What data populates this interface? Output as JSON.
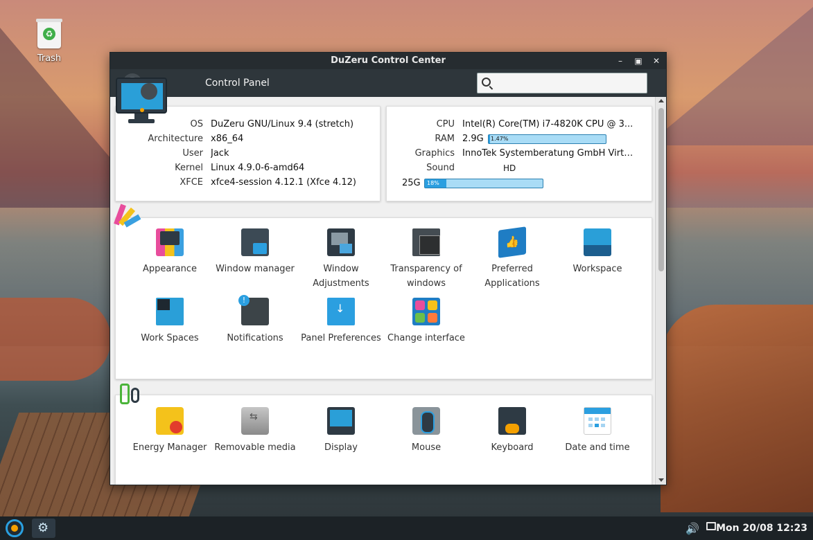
{
  "desktop": {
    "trash_label": "Trash"
  },
  "window": {
    "title": "DuZeru Control Center",
    "controls": [
      "minimize",
      "maximize",
      "close"
    ],
    "toolbar_label": "Control Panel",
    "search_placeholder": ""
  },
  "system_info": {
    "os_label": "OS",
    "os_value": "DuZeru GNU/Linux 9.4 (stretch)",
    "arch_label": "Architecture",
    "arch_value": "x86_64",
    "user_label": "User",
    "user_value": "Jack",
    "kernel_label": "Kernel",
    "kernel_value": "Linux 4.9.0-6-amd64",
    "xfce_label": "XFCE",
    "xfce_value": "xfce4-session 4.12.1 (Xfce 4.12)"
  },
  "hardware_info": {
    "cpu_label": "CPU",
    "cpu_value": "Intel(R) Core(TM) i7-4820K CPU @ 3...",
    "ram_label": "RAM",
    "ram_value": "2.9G",
    "ram_percent_text": "1.47%",
    "ram_percent": 1.47,
    "graphics_label": "Graphics",
    "graphics_value": "InnoTek Systemberatung GmbH Virtu...",
    "sound_label": "Sound",
    "hd_label": "HD",
    "hd_size": "25G",
    "hd_percent_text": "18%",
    "hd_percent": 18,
    "accent_color": "#2b9fe0"
  },
  "appearance_section": {
    "items": [
      {
        "label": "Appearance",
        "icon": "appearance-icon"
      },
      {
        "label": "Window manager",
        "icon": "window-manager-icon"
      },
      {
        "label": "Window Adjustments",
        "icon": "window-adjustments-icon"
      },
      {
        "label": "Transparency of windows",
        "icon": "transparency-icon"
      },
      {
        "label": "Preferred Applications",
        "icon": "preferred-apps-icon"
      },
      {
        "label": "Workspace",
        "icon": "workspace-icon"
      },
      {
        "label": "Work Spaces",
        "icon": "work-spaces-icon"
      },
      {
        "label": "Notifications",
        "icon": "notifications-icon"
      },
      {
        "label": "Panel Preferences",
        "icon": "panel-preferences-icon"
      },
      {
        "label": "Change interface",
        "icon": "change-interface-icon"
      }
    ]
  },
  "hardware_section": {
    "items": [
      {
        "label": "Energy Manager",
        "icon": "energy-manager-icon"
      },
      {
        "label": "Removable media",
        "icon": "removable-media-icon"
      },
      {
        "label": "Display",
        "icon": "display-icon"
      },
      {
        "label": "Mouse",
        "icon": "mouse-icon"
      },
      {
        "label": "Keyboard",
        "icon": "keyboard-icon"
      },
      {
        "label": "Date and time",
        "icon": "date-time-icon"
      }
    ]
  },
  "taskbar": {
    "clock": "Mon 20/08 12:23"
  }
}
